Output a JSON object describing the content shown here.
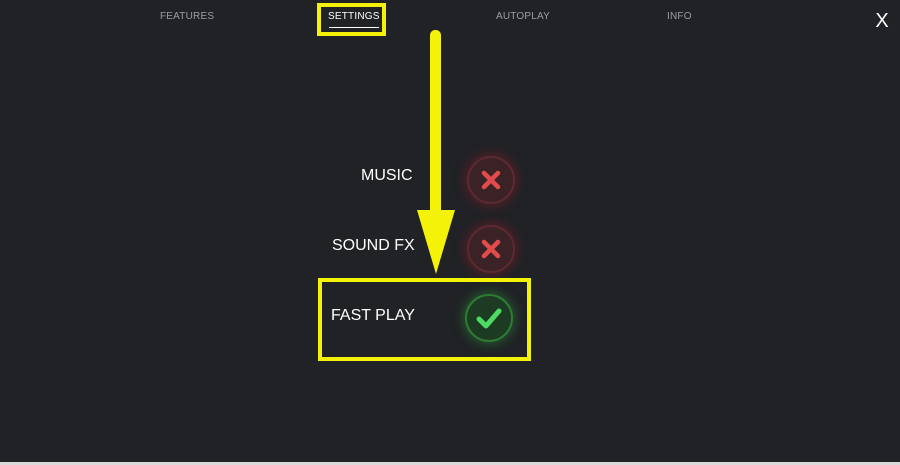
{
  "tabs": [
    {
      "label": "FEATURES",
      "active": false
    },
    {
      "label": "SETTINGS",
      "active": true
    },
    {
      "label": "AUTOPLAY",
      "active": false
    },
    {
      "label": "INFO",
      "active": false
    }
  ],
  "close": {
    "label": "X"
  },
  "settings": [
    {
      "label": "MUSIC",
      "state": "off",
      "icon": "cross-icon"
    },
    {
      "label": "SOUND FX",
      "state": "off",
      "icon": "cross-icon"
    },
    {
      "label": "FAST PLAY",
      "state": "on",
      "icon": "check-icon"
    }
  ],
  "colors": {
    "background": "#202226",
    "annotation": "#f5f20a",
    "off": "#e24b4b",
    "on": "#4cd964"
  }
}
